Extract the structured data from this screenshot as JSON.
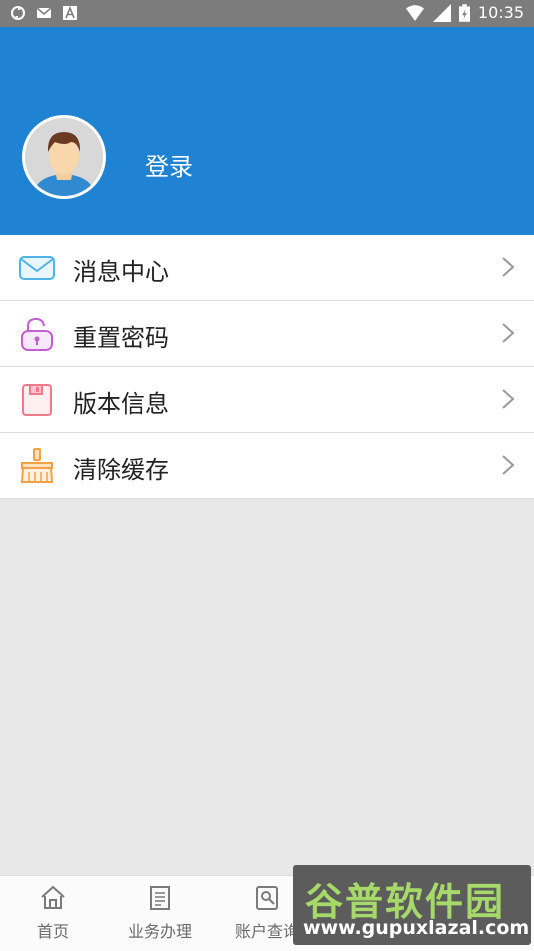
{
  "status_bar": {
    "time": "10:35",
    "icons": [
      "sync-icon",
      "mail-icon",
      "app-icon",
      "wifi-icon",
      "signal-icon",
      "battery-icon"
    ]
  },
  "profile": {
    "login_label": "登录"
  },
  "menu": {
    "items": [
      {
        "label": "消息中心",
        "icon": "mail-icon"
      },
      {
        "label": "重置密码",
        "icon": "unlock-icon"
      },
      {
        "label": "版本信息",
        "icon": "floppy-icon"
      },
      {
        "label": "清除缓存",
        "icon": "broom-icon"
      }
    ]
  },
  "tabbar": {
    "tabs": [
      {
        "label": "首页",
        "icon": "home-icon"
      },
      {
        "label": "业务办理",
        "icon": "document-icon"
      },
      {
        "label": "账户查询",
        "icon": "account-search-icon"
      }
    ]
  },
  "watermark": {
    "title": "谷普软件园",
    "subtitle": "www.gupuxlazal.com"
  },
  "colors": {
    "header_blue": "#1f82d3",
    "status_gray": "#7c7c7c",
    "background": "#e8e8e8",
    "watermark_green": "#a6d86a"
  }
}
